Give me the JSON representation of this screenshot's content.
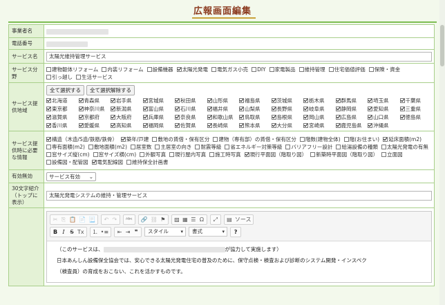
{
  "page": {
    "title": "広報画面編集"
  },
  "labels": {
    "business_name": "事業者名",
    "phone": "電話番号",
    "service_name": "サービス名",
    "service_category": "サービス分野",
    "service_area": "サービス提供地域",
    "required_info": "サービス提供時に必要な情報",
    "enabled": "有効無効",
    "intro_30": "30文字紹介（トップに表示）"
  },
  "service_name_value": "太陽光維持管理サービス",
  "categories": [
    {
      "label": "建物躯体リフォーム",
      "checked": false
    },
    {
      "label": "内装リフォーム",
      "checked": false
    },
    {
      "label": "設備機器",
      "checked": false
    },
    {
      "label": "太陽光発電",
      "checked": true
    },
    {
      "label": "電気ガス小売",
      "checked": false
    },
    {
      "label": "DIY",
      "checked": false
    },
    {
      "label": "家電製品",
      "checked": false
    },
    {
      "label": "維持管理",
      "checked": false
    },
    {
      "label": "住宅価値評価",
      "checked": false
    },
    {
      "label": "保険・資金",
      "checked": false
    },
    {
      "label": "引っ越し",
      "checked": false
    },
    {
      "label": "生活サービス",
      "checked": false
    }
  ],
  "area_buttons": {
    "select_all": "全て選択する",
    "deselect_all": "全て選択解除する"
  },
  "prefectures": [
    "北海道",
    "青森県",
    "岩手県",
    "宮城県",
    "秋田県",
    "山形県",
    "福島県",
    "茨城県",
    "栃木県",
    "群馬県",
    "埼玉県",
    "千葉県",
    "東京都",
    "神奈川県",
    "新潟県",
    "富山県",
    "石川県",
    "福井県",
    "山梨県",
    "長野県",
    "岐阜県",
    "静岡県",
    "愛知県",
    "三重県",
    "滋賀県",
    "京都府",
    "大阪府",
    "兵庫県",
    "奈良県",
    "和歌山県",
    "鳥取県",
    "島根県",
    "岡山県",
    "広島県",
    "山口県",
    "徳島県",
    "香川県",
    "愛媛県",
    "高知県",
    "福岡県",
    "佐賀県",
    "長崎県",
    "熊本県",
    "大分県",
    "宮崎県",
    "鹿児島県",
    "沖縄県"
  ],
  "required_items": [
    {
      "label": "構造（木造/S造/鉄筋/鉄骨）",
      "checked": true
    },
    {
      "label": "築年/戸建",
      "checked": true
    },
    {
      "label": "敷地の賃借・保有区分",
      "checked": false
    },
    {
      "label": "建物（専有部）の賃借・保有区分",
      "checked": false
    },
    {
      "label": "階数(建物全体)",
      "checked": false
    },
    {
      "label": "階(お住まい)",
      "checked": false
    },
    {
      "label": "延床面積(m2)",
      "checked": true
    },
    {
      "label": "専有面積(m2)",
      "checked": false
    },
    {
      "label": "敷地面積(m2)",
      "checked": false
    },
    {
      "label": "居室数",
      "checked": false
    },
    {
      "label": "主居室の向き",
      "checked": false
    },
    {
      "label": "耐震等級",
      "checked": false
    },
    {
      "label": "省エネルギー対策等級",
      "checked": false
    },
    {
      "label": "バリアフリー設計",
      "checked": false
    },
    {
      "label": "給湯設備の種類",
      "checked": false
    },
    {
      "label": "太陽光発電の有無",
      "checked": false
    },
    {
      "label": "窓サイズ縦(cm)",
      "checked": false
    },
    {
      "label": "窓サイズ横(cm)",
      "checked": false
    },
    {
      "label": "外観写真",
      "checked": false
    },
    {
      "label": "現行屋内写真",
      "checked": false
    },
    {
      "label": "施工時写真",
      "checked": false
    },
    {
      "label": "現行平面図（階取り図）",
      "checked": true
    },
    {
      "label": "新築時平面図（階取り図）",
      "checked": false
    },
    {
      "label": "立面図",
      "checked": false
    },
    {
      "label": "設備図・配管図",
      "checked": false
    },
    {
      "label": "電気配線図",
      "checked": true
    },
    {
      "label": "維持保全計画書",
      "checked": false
    }
  ],
  "enabled_value": "サービス有効",
  "intro_value": "太陽光発電システムの維持・管理サービス",
  "editor": {
    "source_label": "ソース",
    "style_label": "スタイル",
    "format_label": "書式",
    "line1_prefix": "（このサービスは、",
    "line1_suffix": "が協力して実施します）",
    "line2": "日本あんしん設備保全協会では、安心できる太陽光発電住宅の普及のために、保守点検・検査および診断のシステム開発・インスペク",
    "line3": "（検査員）の育成をおこない、これを活かすものです。"
  }
}
